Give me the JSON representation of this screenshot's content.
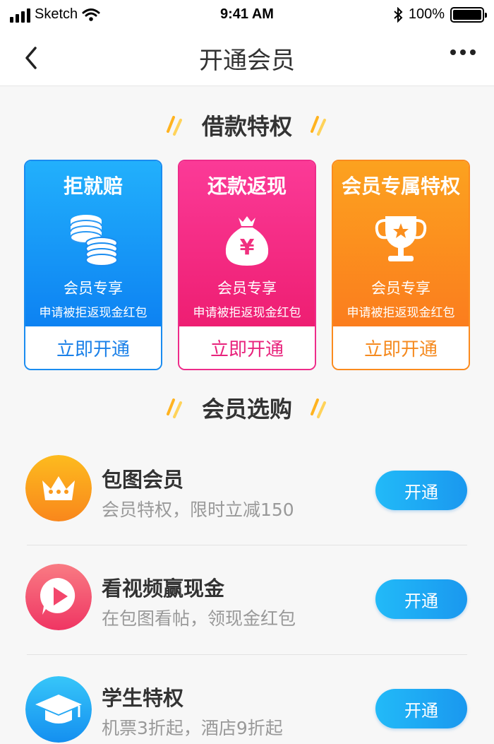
{
  "status_bar": {
    "carrier": "Sketch",
    "time": "9:41 AM",
    "battery": "100%"
  },
  "nav": {
    "title": "开通会员"
  },
  "privilege_section": {
    "title": "借款特权",
    "cards": [
      {
        "title": "拒就赔",
        "icon": "coins-icon",
        "subtitle": "会员专享",
        "desc": "申请被拒返现金红包",
        "button": "立即开通",
        "color": "#1a8cf0"
      },
      {
        "title": "还款返现",
        "icon": "money-bag-icon",
        "subtitle": "会员专享",
        "desc": "申请被拒返现金红包",
        "button": "立即开通",
        "color": "#ee2c8a"
      },
      {
        "title": "会员专属特权",
        "icon": "trophy-icon",
        "subtitle": "会员专享",
        "desc": "申请被拒返现金红包",
        "button": "立即开通",
        "color": "#fb8b1e"
      }
    ]
  },
  "purchase_section": {
    "title": "会员选购",
    "items": [
      {
        "title": "包图会员",
        "subtitle": "会员特权，限时立减150",
        "button": "开通",
        "icon": "crown-icon",
        "color": "#fb9f1c"
      },
      {
        "title": "看视频赢现金",
        "subtitle": "在包图看帖，领现金红包",
        "button": "开通",
        "icon": "play-icon",
        "color": "#f4566f"
      },
      {
        "title": "学生特权",
        "subtitle": "机票3折起，酒店9折起",
        "button": "开通",
        "icon": "graduation-cap-icon",
        "color": "#1aa2f0"
      }
    ]
  },
  "money_bag_symbol": "¥"
}
